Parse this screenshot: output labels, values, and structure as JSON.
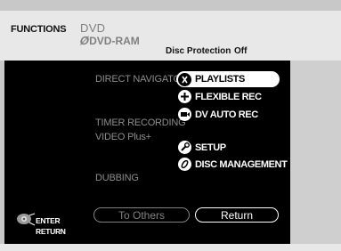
{
  "header": {
    "title": "FUNCTIONS",
    "media_line1": "DVD",
    "media_line2": "DVD-RAM",
    "protection_label": "Disc Protection",
    "protection_value": "Off"
  },
  "categories": {
    "direct_navigator": "DIRECT NAVIGATOR",
    "timer_recording": "TIMER RECORDING",
    "video_plus": "VIDEO Plus+",
    "dubbing": "DUBBING"
  },
  "menu": {
    "playlists": "PLAYLISTS",
    "flexible_rec": "FLEXIBLE REC",
    "dv_auto_rec": "DV AUTO REC",
    "setup": "SETUP",
    "disc_management": "DISC MANAGEMENT"
  },
  "buttons": {
    "to_others": "To Others",
    "return": "Return"
  },
  "remote_hint": {
    "enter": "ENTER",
    "return": "RETURN"
  }
}
